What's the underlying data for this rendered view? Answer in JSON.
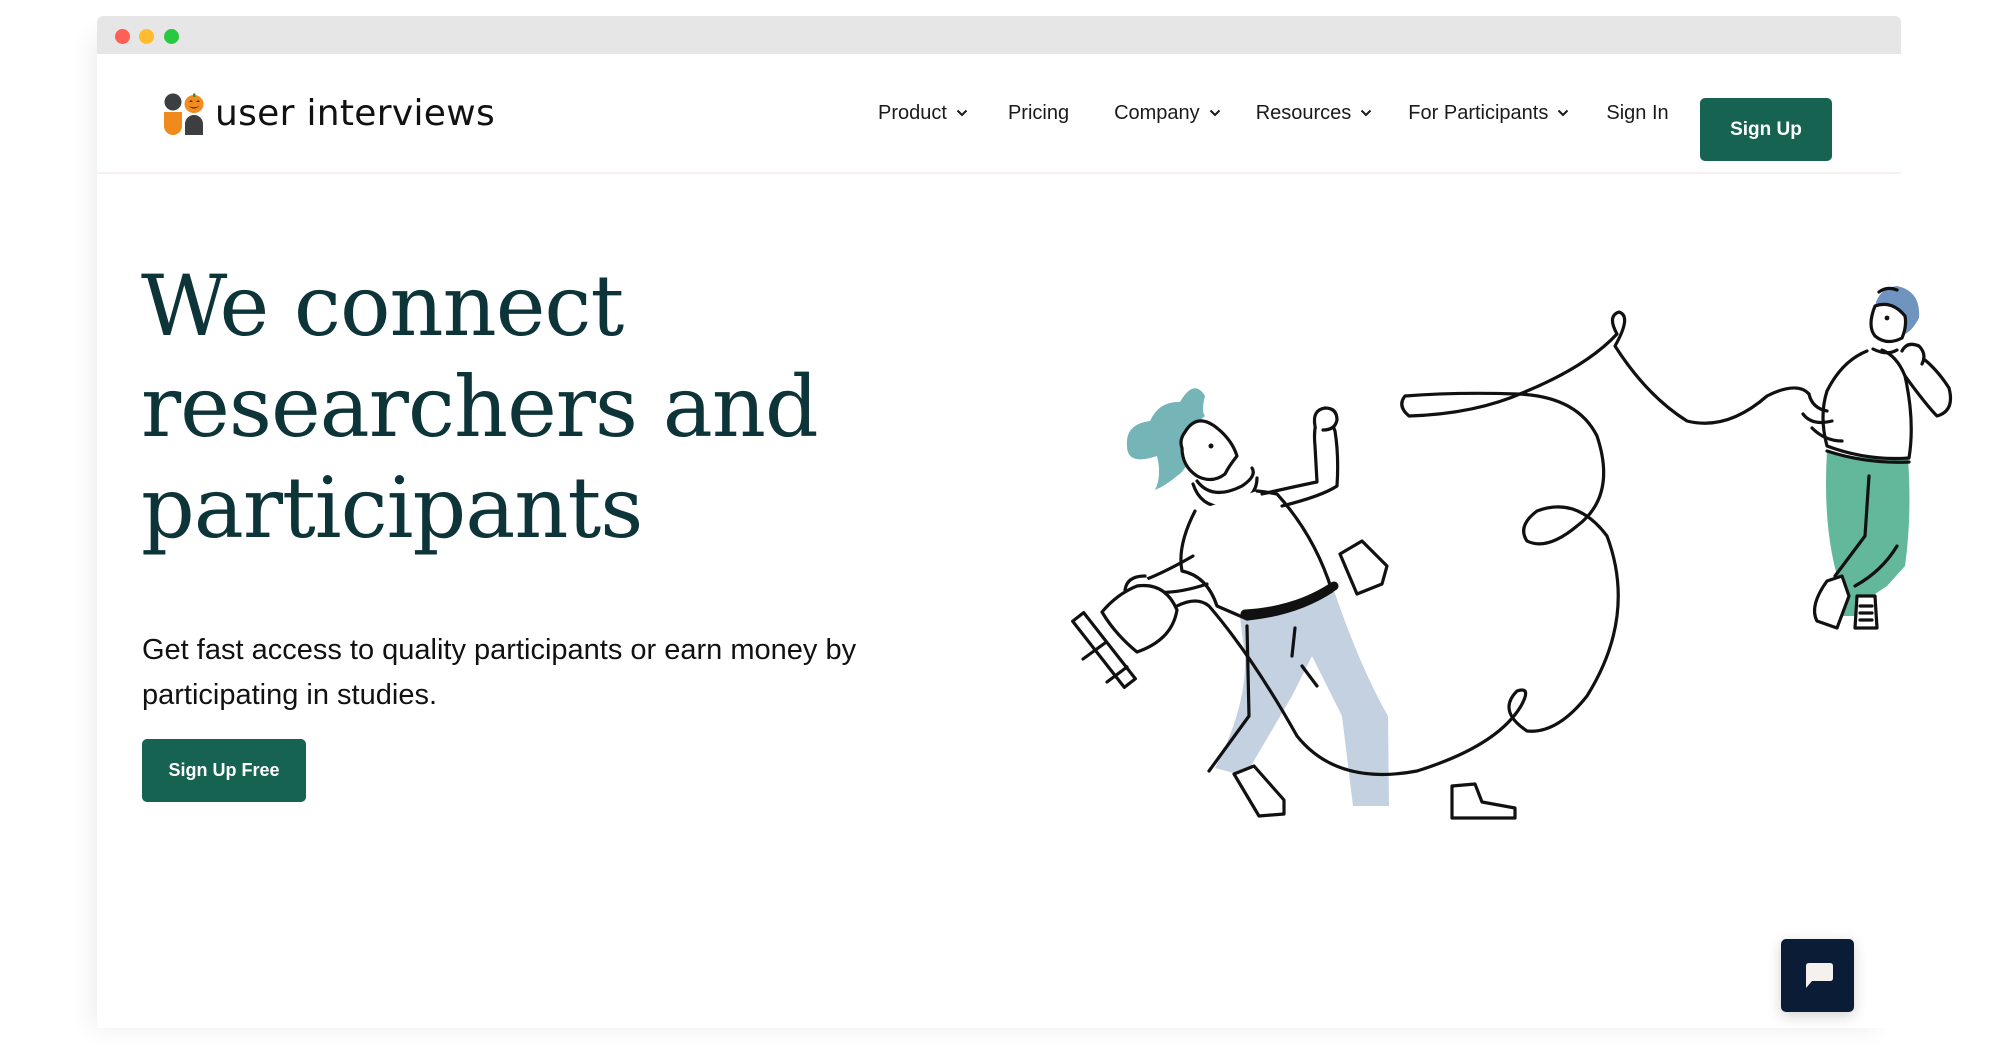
{
  "browser": {
    "controls": [
      "close",
      "minimize",
      "maximize"
    ]
  },
  "header": {
    "logo_text": "user interviews",
    "logo_icon": "user-interviews-pumpkin-logo",
    "nav": [
      {
        "label": "Product",
        "has_dropdown": true
      },
      {
        "label": "Pricing",
        "has_dropdown": false
      },
      {
        "label": "Company",
        "has_dropdown": true
      },
      {
        "label": "Resources",
        "has_dropdown": true
      },
      {
        "label": "For Participants",
        "has_dropdown": true
      },
      {
        "label": "Sign In",
        "has_dropdown": false
      }
    ],
    "signup_label": "Sign Up"
  },
  "hero": {
    "title_lines": [
      "We connect",
      "researchers and",
      "participants"
    ],
    "subtitle": "Get fast access to quality participants or earn money by participating in studies.",
    "cta_label": "Sign Up Free",
    "illustration": "two people connected by a long cord with a plug"
  },
  "chat": {
    "icon": "chat-bubble-icon"
  },
  "colors": {
    "brand_green": "#176352",
    "heading": "#0d3438",
    "chat_navy": "#0b1c36",
    "hair_teal": "#75b5b8",
    "pants_blue": "#c3d1e0",
    "hair_blue": "#6f94bf",
    "pants_green": "#63b79a",
    "logo_orange": "#f08a1c"
  }
}
